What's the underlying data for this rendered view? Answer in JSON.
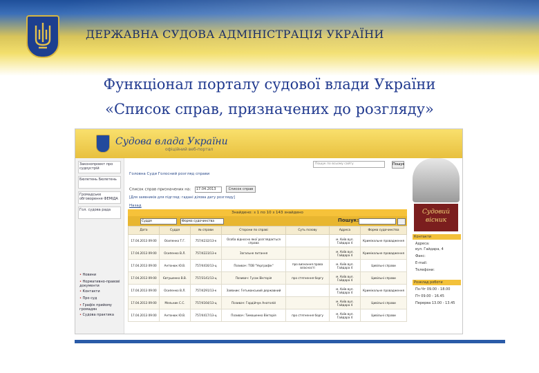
{
  "banner": {
    "agency": "ДЕРЖАВНА СУДОВА АДМІНІСТРАЦІЯ УКРАЇНИ",
    "colors": {
      "blue": "#1f4f9a",
      "yellow": "#f3df6c"
    },
    "emblem_icon": "trident-emblem-icon"
  },
  "slide": {
    "title_line1": "Функціонал порталу судової влади України",
    "title_line2": "«Список справ, призначених до розгляду»",
    "title_color": "#213a8f"
  },
  "portal": {
    "logo": "Судова влада України",
    "tagline": "офіційний веб-портал",
    "search_placeholder": "Пошук по всьому сайту",
    "search_button": "Пошук",
    "nav": "Головна  Суди  Голосний розгляд справи",
    "form_label": "Список справ призначених на:",
    "date_value": "17.04.2013",
    "show_button": "Список справ",
    "note": "[Для заявників для підгляд: гадані ділова дату розгляду]",
    "back_link": "Назад",
    "bar_text": "Знайдено: з 1 по 10 з 143 знайдено",
    "court_select": "Суддя",
    "form_select": "Форма судочинства",
    "search_label": "Пошук:",
    "left_banners": [
      "Законопроект про судоустрій",
      "Бюлетень Бюлетень",
      "Громадське обговорення ФЕМІДА",
      "Гол. судова рада"
    ],
    "left_menu": [
      "Новини",
      "Нормативно-правові документи",
      "Контакти",
      "Про суд",
      "Графік прийому громадян",
      "Судова практика"
    ],
    "columns": [
      "Дата",
      "Суддя",
      "№ справи",
      "Сторони по справі",
      "Суть позову",
      "Адреса",
      "Форма судочинства"
    ],
    "rows": [
      [
        "17.04.2013 09:00",
        "Осипенко Т.Г.",
        "757/4232/13-к",
        "Особа відносно якої розглядається справа",
        "",
        "м. Київ вул. Гайдара 4",
        "Кримінальне провадження"
      ],
      [
        "17.04.2013 09:00",
        "Осипенко В.Л.",
        "757/4223/13-к",
        "Загальне питання",
        "",
        "м. Київ вул. Гайдара 4",
        "Кримінальне провадження"
      ],
      [
        "17.04.2013 09:00",
        "Антонюк Ю.В.",
        "757/4416/13-ц",
        "Позивач: ТОВ \"Укрграфік\"",
        "про визнання права власності",
        "м. Київ вул. Гайдара 4",
        "Цивільні справи"
      ],
      [
        "17.04.2013 09:00",
        "Євтушенко В.В.",
        "757/3141/13-ц",
        "Позивач: Гусак Вікторія",
        "про стягнення боргу",
        "м. Київ вул. Гайдара 4",
        "Цивільні справи"
      ],
      [
        "17.04.2013 09:00",
        "Осипенко В.Л.",
        "757/4291/13-к",
        "Заявник: Гетьманський державний",
        "",
        "м. Київ вул. Гайдара 4",
        "Кримінальне провадження"
      ],
      [
        "17.04.2013 09:00",
        "Мельник С.С.",
        "757/4164/13-ц",
        "Позивач: Гордійчук Анатолій",
        "",
        "м. Київ вул. Гайдара 4",
        "Цивільні справи"
      ],
      [
        "17.04.2013 09:00",
        "Антонюк Ю.В.",
        "757/4417/13-ц",
        "Позивач: Тимошенко Вікторія",
        "про стягнення боргу",
        "м. Київ вул. Гайдара 4",
        "Цивільні справи"
      ]
    ],
    "right": {
      "vestnik": "Судовий вісник",
      "contacts_header": "Контакти",
      "contacts": [
        "Адреса:",
        "вул. Гайдара, 4",
        "Факс:",
        "E-mail:",
        "Телефони:"
      ],
      "schedule_header": "Розклад роботи",
      "schedule": [
        "Пн-Чт 09.00 - 18.00",
        "Пт 09.00 - 16.45",
        "Перерва 13.00 - 13.45"
      ]
    }
  }
}
